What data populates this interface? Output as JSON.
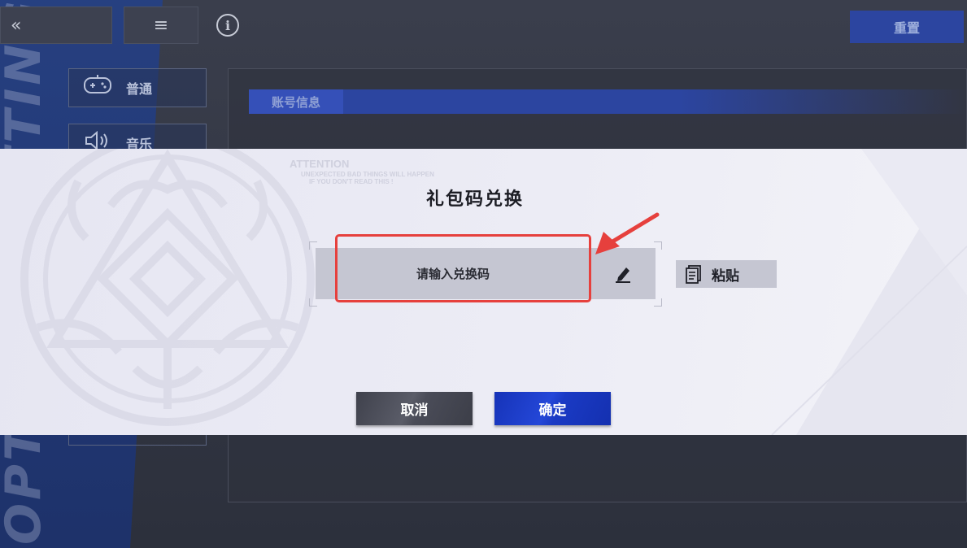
{
  "background": {
    "side_text": "OPTIONS SETTINGS",
    "top_bar": {
      "back_icon": "double-chevron-left-icon",
      "menu_icon": "hamburger-menu-icon",
      "info_icon": "info-circle-icon",
      "reset_label": "重置"
    },
    "sidebar": {
      "items": [
        {
          "label": "普通",
          "icon": "gamepad-icon"
        },
        {
          "label": "音乐",
          "icon": "speaker-icon"
        }
      ]
    },
    "section_label": "账号信息"
  },
  "dialog": {
    "attention": {
      "heading": "ATTENTION",
      "line1": "UNEXPECTED BAD THINGS WILL HAPPEN",
      "line2": "IF YOU DON'T READ THIS !"
    },
    "title": "礼包码兑换",
    "code_input": {
      "placeholder": "请输入兑换码",
      "value": ""
    },
    "edit_icon": "pencil-icon",
    "paste": {
      "label": "粘贴",
      "icon": "clipboard-icon"
    },
    "cancel_label": "取消",
    "confirm_label": "确定"
  },
  "annotation": {
    "highlight_color": "#e6403d"
  }
}
